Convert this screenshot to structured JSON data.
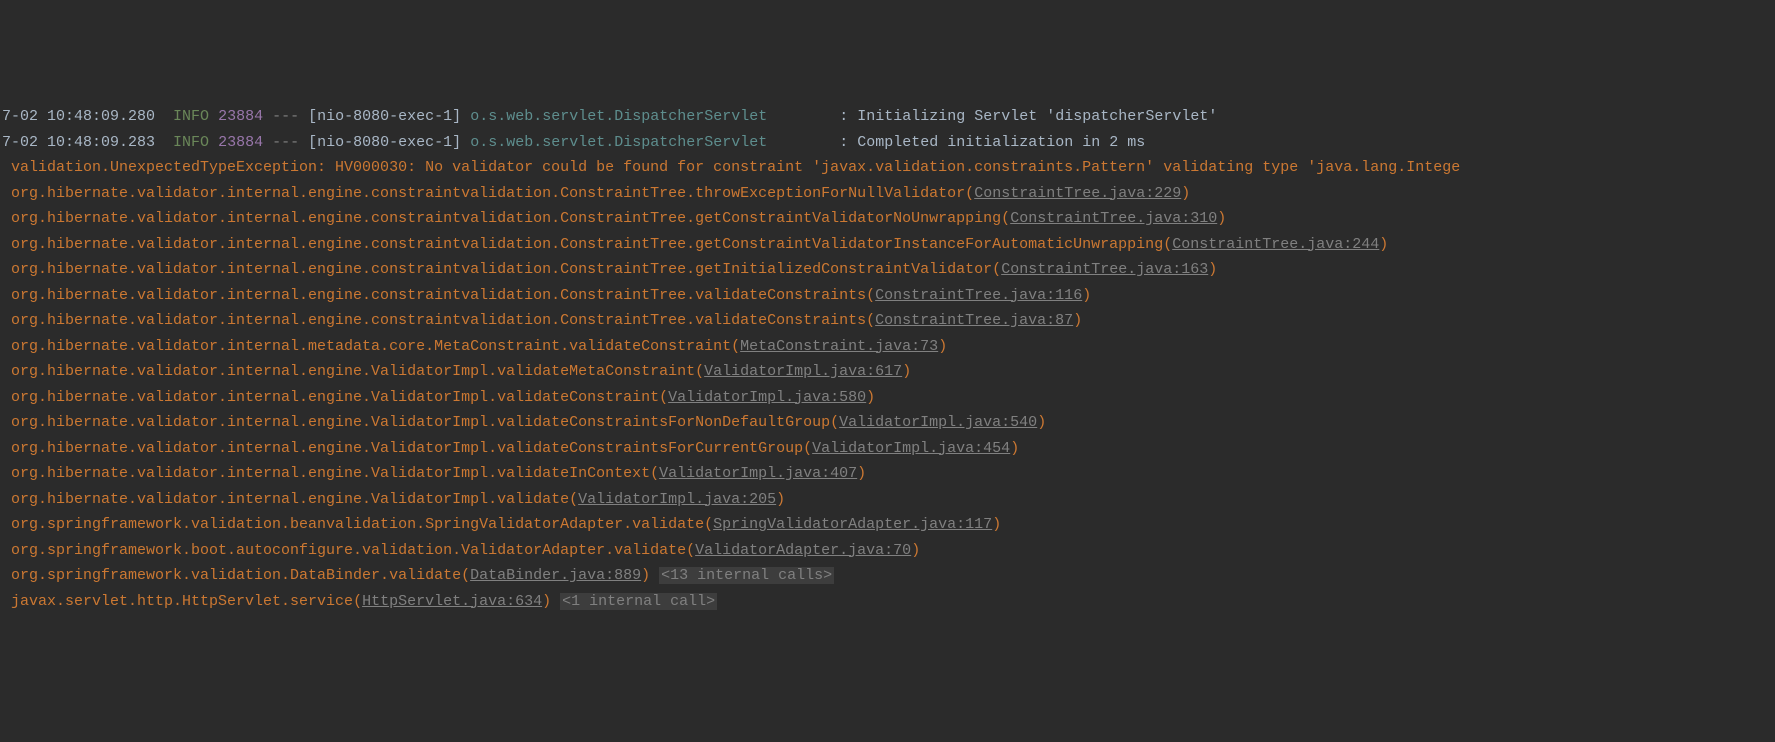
{
  "log_lines": [
    {
      "timestamp": "7-02 10:48:09.280",
      "level": "INFO",
      "pid": "23884",
      "separator": "---",
      "thread": "[nio-8080-exec-1]",
      "logger": "o.s.web.servlet.DispatcherServlet",
      "colon": " : ",
      "message": "Initializing Servlet 'dispatcherServlet'"
    },
    {
      "timestamp": "7-02 10:48:09.283",
      "level": "INFO",
      "pid": "23884",
      "separator": "---",
      "thread": "[nio-8080-exec-1]",
      "logger": "o.s.web.servlet.DispatcherServlet",
      "colon": " : ",
      "message": "Completed initialization in 2 ms"
    }
  ],
  "exception_line": "validation.UnexpectedTypeException: HV000030: No validator could be found for constraint 'javax.validation.constraints.Pattern' validating type 'java.lang.Intege",
  "stack_frames": [
    {
      "method": "org.hibernate.validator.internal.engine.constraintvalidation.ConstraintTree.throwExceptionForNullValidator",
      "file": "ConstraintTree.java",
      "line": "229"
    },
    {
      "method": "org.hibernate.validator.internal.engine.constraintvalidation.ConstraintTree.getConstraintValidatorNoUnwrapping",
      "file": "ConstraintTree.java",
      "line": "310"
    },
    {
      "method": "org.hibernate.validator.internal.engine.constraintvalidation.ConstraintTree.getConstraintValidatorInstanceForAutomaticUnwrapping",
      "file": "ConstraintTree.java",
      "line": "244"
    },
    {
      "method": "org.hibernate.validator.internal.engine.constraintvalidation.ConstraintTree.getInitializedConstraintValidator",
      "file": "ConstraintTree.java",
      "line": "163"
    },
    {
      "method": "org.hibernate.validator.internal.engine.constraintvalidation.ConstraintTree.validateConstraints",
      "file": "ConstraintTree.java",
      "line": "116"
    },
    {
      "method": "org.hibernate.validator.internal.engine.constraintvalidation.ConstraintTree.validateConstraints",
      "file": "ConstraintTree.java",
      "line": "87"
    },
    {
      "method": "org.hibernate.validator.internal.metadata.core.MetaConstraint.validateConstraint",
      "file": "MetaConstraint.java",
      "line": "73"
    },
    {
      "method": "org.hibernate.validator.internal.engine.ValidatorImpl.validateMetaConstraint",
      "file": "ValidatorImpl.java",
      "line": "617"
    },
    {
      "method": "org.hibernate.validator.internal.engine.ValidatorImpl.validateConstraint",
      "file": "ValidatorImpl.java",
      "line": "580"
    },
    {
      "method": "org.hibernate.validator.internal.engine.ValidatorImpl.validateConstraintsForNonDefaultGroup",
      "file": "ValidatorImpl.java",
      "line": "540"
    },
    {
      "method": "org.hibernate.validator.internal.engine.ValidatorImpl.validateConstraintsForCurrentGroup",
      "file": "ValidatorImpl.java",
      "line": "454"
    },
    {
      "method": "org.hibernate.validator.internal.engine.ValidatorImpl.validateInContext",
      "file": "ValidatorImpl.java",
      "line": "407"
    },
    {
      "method": "org.hibernate.validator.internal.engine.ValidatorImpl.validate",
      "file": "ValidatorImpl.java",
      "line": "205"
    },
    {
      "method": "org.springframework.validation.beanvalidation.SpringValidatorAdapter.validate",
      "file": "SpringValidatorAdapter.java",
      "line": "117"
    },
    {
      "method": "org.springframework.boot.autoconfigure.validation.ValidatorAdapter.validate",
      "file": "ValidatorAdapter.java",
      "line": "70"
    },
    {
      "method": "org.springframework.validation.DataBinder.validate",
      "file": "DataBinder.java",
      "line": "889",
      "internal": "<13 internal calls>"
    },
    {
      "method": "javax.servlet.http.HttpServlet.service",
      "file": "HttpServlet.java",
      "line": "634",
      "internal": "<1 internal call>"
    }
  ],
  "logger_spacing": "       "
}
